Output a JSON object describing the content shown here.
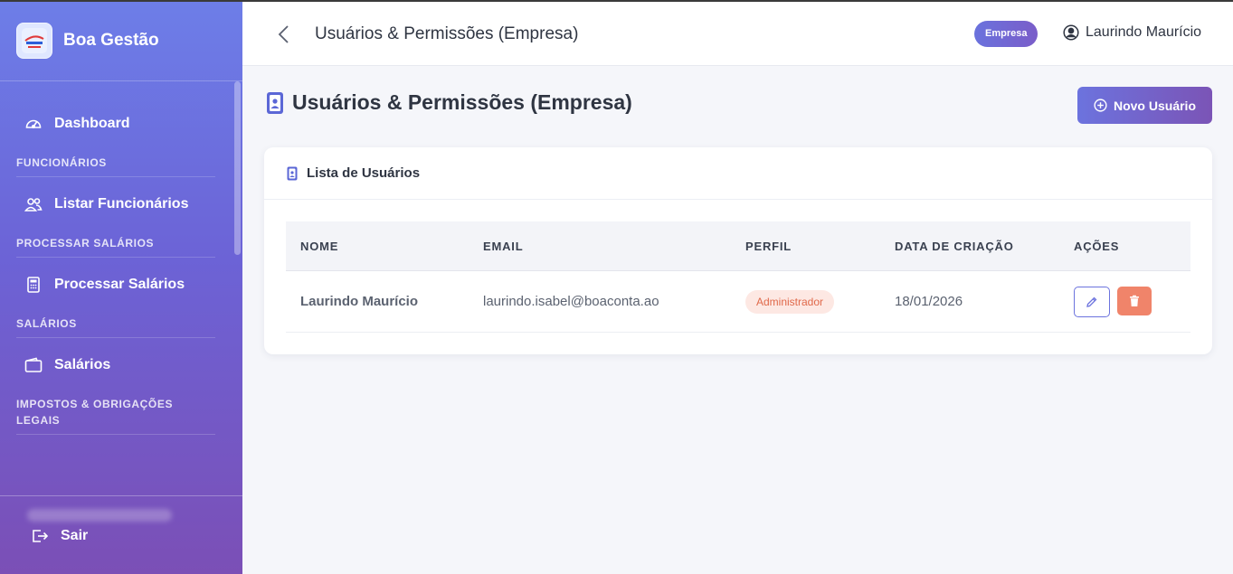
{
  "brand": {
    "name": "Boa Gestão"
  },
  "sidebar": {
    "dashboard": "Dashboard",
    "sections": [
      {
        "title": "FUNCIONÁRIOS",
        "item": "Listar Funcionários"
      },
      {
        "title": "PROCESSAR SALÁRIOS",
        "item": "Processar Salários"
      },
      {
        "title": "SALÁRIOS",
        "item": "Salários"
      },
      {
        "title": "IMPOSTOS & OBRIGAÇÕES LEGAIS"
      }
    ],
    "logout": "Sair"
  },
  "header": {
    "title": "Usuários & Permissões (Empresa)",
    "badge": "Empresa",
    "user": "Laurindo Maurício"
  },
  "main": {
    "title": "Usuários & Permissões (Empresa)",
    "new_user_button": "Novo Usuário",
    "card_title": "Lista de Usuários",
    "columns": [
      "NOME",
      "EMAIL",
      "PERFIL",
      "DATA DE CRIAÇÃO",
      "AÇÕES"
    ],
    "rows": [
      {
        "name": "Laurindo Maurício",
        "email": "laurindo.isabel@boaconta.ao",
        "role": "Administrador",
        "created": "18/01/2026"
      }
    ]
  },
  "colors": {
    "accent": "#6c73de",
    "danger": "#f0846a",
    "role_bg": "#fde8e3"
  }
}
